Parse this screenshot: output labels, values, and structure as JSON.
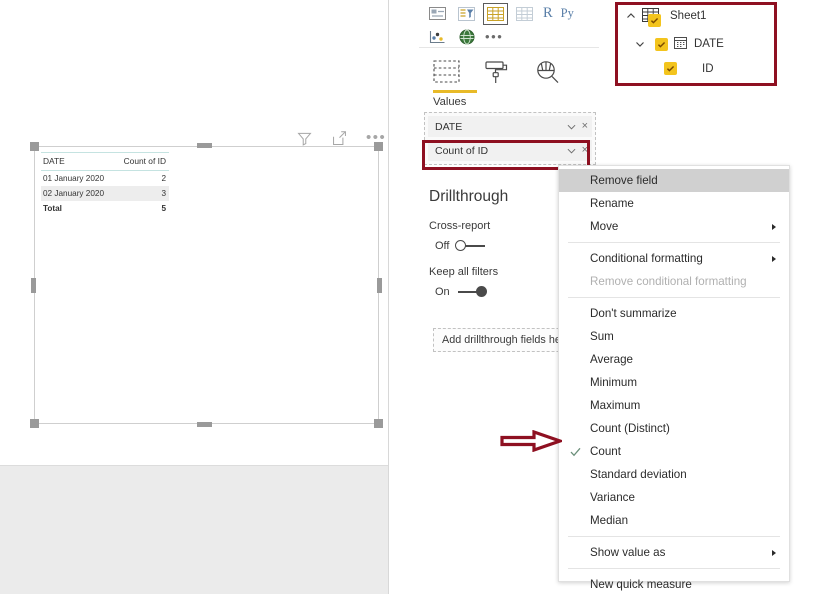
{
  "canvas": {
    "visual_header": {
      "filter_icon": "filter-icon",
      "focus_icon": "focus-mode-icon",
      "more_label": "•••"
    },
    "table_visual": {
      "columns": [
        "DATE",
        "Count of ID"
      ],
      "rows": [
        {
          "date": "01 January 2020",
          "count": "2"
        },
        {
          "date": "02 January 2020",
          "count": "3"
        }
      ],
      "total": {
        "label": "Total",
        "count": "5"
      }
    }
  },
  "visualizations": {
    "gallery_row1": [
      "card-icon",
      "slicer-icon",
      "table-icon",
      "matrix-icon",
      "R",
      "Py"
    ],
    "gallery_row2": [
      "scatter-icon",
      "globe-map-icon",
      "•••"
    ],
    "well_tabs": {
      "fields_icon": "fields-well-icon",
      "format_icon": "paint-roller-icon",
      "analytics_icon": "magnifier-analytics-icon",
      "active_label": "Values",
      "underline_color": "#e8ba28"
    },
    "wells": [
      {
        "label": "DATE",
        "chevron": "chevron-down-icon",
        "remove": "×"
      },
      {
        "label": "Count of ID",
        "chevron": "chevron-down-icon",
        "remove": "×"
      }
    ],
    "highlight_color": "#8e1021",
    "drillthrough": {
      "title": "Drillthrough",
      "cross_report": {
        "label": "Cross-report",
        "state": "Off"
      },
      "keep_all_filters": {
        "label": "Keep all filters",
        "state": "On"
      },
      "add_fields_placeholder": "Add drillthrough fields here"
    }
  },
  "fields_tree": {
    "nodes": [
      {
        "label": "Sheet1",
        "chevron": "chevron-up-icon",
        "icon": "table-field-icon",
        "checked": true,
        "level": 0
      },
      {
        "label": "DATE",
        "chevron": "chevron-down-icon",
        "icon": "calendar-field-icon",
        "checked": true,
        "level": 1
      },
      {
        "label": "ID",
        "chevron": "",
        "icon": "",
        "checked": true,
        "level": 2
      }
    ]
  },
  "context_menu": {
    "items": [
      {
        "label": "Remove field",
        "highlighted": true,
        "submenu": false,
        "checked": false,
        "disabled": false
      },
      {
        "label": "Rename",
        "highlighted": false,
        "submenu": false,
        "checked": false,
        "disabled": false
      },
      {
        "label": "Move",
        "highlighted": false,
        "submenu": true,
        "checked": false,
        "disabled": false
      },
      {
        "separator": true
      },
      {
        "label": "Conditional formatting",
        "highlighted": false,
        "submenu": true,
        "checked": false,
        "disabled": false
      },
      {
        "label": "Remove conditional formatting",
        "highlighted": false,
        "submenu": false,
        "checked": false,
        "disabled": true
      },
      {
        "separator": true
      },
      {
        "label": "Don't summarize",
        "highlighted": false,
        "submenu": false,
        "checked": false,
        "disabled": false
      },
      {
        "label": "Sum",
        "highlighted": false,
        "submenu": false,
        "checked": false,
        "disabled": false
      },
      {
        "label": "Average",
        "highlighted": false,
        "submenu": false,
        "checked": false,
        "disabled": false
      },
      {
        "label": "Minimum",
        "highlighted": false,
        "submenu": false,
        "checked": false,
        "disabled": false
      },
      {
        "label": "Maximum",
        "highlighted": false,
        "submenu": false,
        "checked": false,
        "disabled": false
      },
      {
        "label": "Count (Distinct)",
        "highlighted": false,
        "submenu": false,
        "checked": false,
        "disabled": false
      },
      {
        "label": "Count",
        "highlighted": false,
        "submenu": false,
        "checked": true,
        "disabled": false
      },
      {
        "label": "Standard deviation",
        "highlighted": false,
        "submenu": false,
        "checked": false,
        "disabled": false
      },
      {
        "label": "Variance",
        "highlighted": false,
        "submenu": false,
        "checked": false,
        "disabled": false
      },
      {
        "label": "Median",
        "highlighted": false,
        "submenu": false,
        "checked": false,
        "disabled": false
      },
      {
        "separator": true
      },
      {
        "label": "Show value as",
        "highlighted": false,
        "submenu": true,
        "checked": false,
        "disabled": false
      },
      {
        "separator": true
      },
      {
        "label": "New quick measure",
        "highlighted": false,
        "submenu": false,
        "checked": false,
        "disabled": false
      }
    ]
  },
  "annotations": {
    "arrow_color": "#8e1021",
    "arrow_points_to": "Count"
  }
}
